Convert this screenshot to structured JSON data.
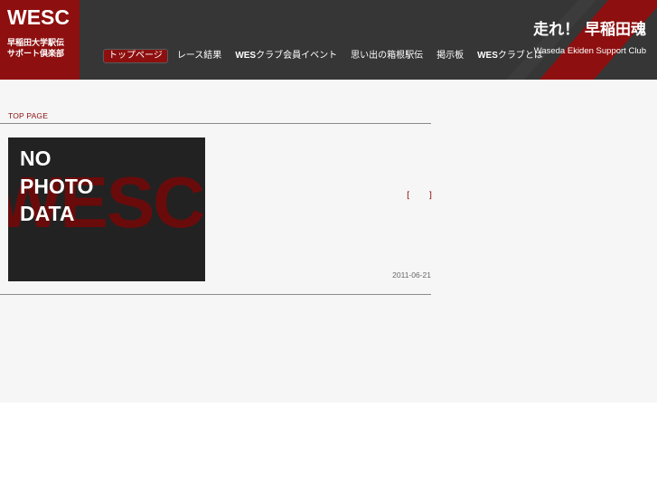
{
  "colors": {
    "header_bg": "#363636",
    "brand_red": "#8e0f0f",
    "content_bg": "#f6f6f6",
    "rule": "#8a8a8a"
  },
  "logo": {
    "main": "WESC",
    "sub_line1": "早稲田大学駅伝",
    "sub_line2": "サポート倶楽部"
  },
  "nav": {
    "items": [
      {
        "bold": "",
        "label": "トップページ",
        "active": true
      },
      {
        "bold": "",
        "label": "レース結果",
        "active": false
      },
      {
        "bold": "WES",
        "label": "クラブ会員イベント",
        "active": false
      },
      {
        "bold": "",
        "label": "思い出の箱根駅伝",
        "active": false
      },
      {
        "bold": "",
        "label": "掲示板",
        "active": false
      },
      {
        "bold": "WES",
        "label": "クラブとは",
        "active": false
      }
    ]
  },
  "tagline": {
    "jp": "走れ！ 早稲田魂",
    "en": "Waseda Ekiden Support Club"
  },
  "content": {
    "breadcrumb": "TOP PAGE",
    "photo": {
      "line1": "NO",
      "line2": "PHOTO",
      "line3": "DATA",
      "watermark": "WESC"
    },
    "bracket_open": "[",
    "bracket_close": "]",
    "date": "2011-06-21"
  }
}
